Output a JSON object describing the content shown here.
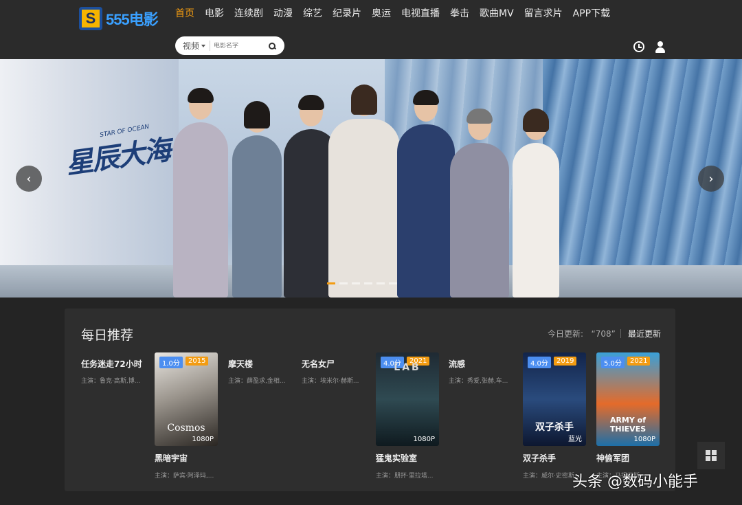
{
  "logo": {
    "mark": "S",
    "text": "555电影"
  },
  "nav": [
    {
      "label": "首页",
      "active": true
    },
    {
      "label": "电影"
    },
    {
      "label": "连续剧"
    },
    {
      "label": "动漫"
    },
    {
      "label": "综艺"
    },
    {
      "label": "纪录片"
    },
    {
      "label": "奥运"
    },
    {
      "label": "电视直播"
    },
    {
      "label": "拳击"
    },
    {
      "label": "歌曲MV"
    },
    {
      "label": "留言求片"
    },
    {
      "label": "APP下载"
    }
  ],
  "search": {
    "type_label": "视频",
    "placeholder": "电影名字"
  },
  "header_icons": [
    "clock-icon",
    "user-icon"
  ],
  "banner": {
    "title": "星辰大海",
    "subtitle": "STAR OF OCEAN",
    "prev": "‹",
    "next": "›",
    "slide_count": 6,
    "active_slide": 0
  },
  "daily": {
    "title": "每日推荐",
    "update_label": "今日更新:",
    "update_count": "“708”",
    "latest_label": "最近更新",
    "text_items": [
      {
        "title": "任务迷走72小时",
        "cast": "主演：鲁克·高斯,博..."
      },
      {
        "title": "摩天楼",
        "cast": "主演：薛盈求,金相..."
      },
      {
        "title": "无名女尸",
        "cast": "主演：埃米尔·赫斯..."
      },
      {
        "title": "流感",
        "cast": "主演：秀爱,张赫,车..."
      }
    ],
    "poster_items": [
      {
        "title": "黑暗宇宙",
        "cast": "主演：萨宾·阿泽玛,...",
        "score": "1.0分",
        "year": "2015",
        "quality": "1080P",
        "caption": "Cosmos"
      },
      {
        "title": "猛鬼实验室",
        "cast": "主演：朋抔·里拉塔...",
        "score": "4.0分",
        "year": "2021",
        "quality": "1080P",
        "caption": "LAB"
      },
      {
        "title": "双子杀手",
        "cast": "主演：威尔·史密斯...",
        "score": "4.0分",
        "year": "2019",
        "quality": "蓝光",
        "caption": "双子杀手"
      },
      {
        "title": "神偷军团",
        "cast": "主演：马提亚斯·...",
        "score": "5.0分",
        "year": "2021",
        "quality": "1080P",
        "caption": "ARMY of THIEVES"
      }
    ]
  },
  "watermark": "头条 @数码小能手"
}
